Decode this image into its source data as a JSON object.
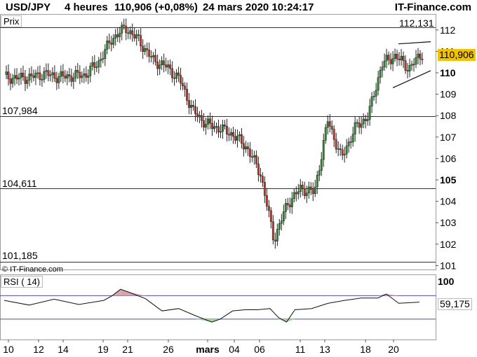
{
  "header": {
    "symbol": "USD/JPY",
    "timeframe": "4 heures",
    "price_change": "110,906 (+0,08%)",
    "datetime": "24 mars 2020 10:24:17",
    "brand": "IT-Finance.com"
  },
  "price_panel": {
    "label": "Prix",
    "watermark": "© IT-Finance.com",
    "last_price": "110,906",
    "last_price_color": "#f2c200",
    "levels": [
      {
        "label": "112,131",
        "value": 112.131
      },
      {
        "label": "107,984",
        "value": 107.984
      },
      {
        "label": "104,611",
        "value": 104.611
      },
      {
        "label": "101,185",
        "value": 101.185
      }
    ]
  },
  "rsi_panel": {
    "label": "RSI ( 14)",
    "last_value": "59,175",
    "top_tick": "100"
  },
  "colors": {
    "up": "#2e8b2e",
    "down": "#c0392b",
    "rsi_overbought_fill": "#d9a5a5",
    "rsi_oversold_fill": "#a9d9a9",
    "band_line": "#4b4bb4"
  },
  "chart_data": [
    {
      "type": "candlestick",
      "title": "USD/JPY",
      "x_tick_labels": [
        "10",
        "12",
        "14",
        "19",
        "21",
        "26",
        "mars",
        "04",
        "06",
        "11",
        "13",
        "18",
        "20"
      ],
      "y_tick_labels": [
        "101",
        "102",
        "103",
        "104",
        "105",
        "106",
        "107",
        "108",
        "109",
        "110",
        "111",
        "112"
      ],
      "y_bold_ticks": [
        "105",
        "110"
      ],
      "ylim": [
        101.0,
        112.4
      ],
      "horizontal_levels": [
        112.131,
        107.984,
        104.611,
        101.185
      ],
      "last_price": 110.906,
      "close_path": [
        {
          "date": "Feb 07",
          "close": 109.8
        },
        {
          "date": "Feb 10",
          "close": 109.75
        },
        {
          "date": "Feb 12",
          "close": 109.8
        },
        {
          "date": "Feb 13",
          "close": 109.95
        },
        {
          "date": "Feb 14",
          "close": 109.8
        },
        {
          "date": "Feb 17",
          "close": 109.85
        },
        {
          "date": "Feb 18",
          "close": 109.9
        },
        {
          "date": "Feb 19",
          "close": 110.5
        },
        {
          "date": "Feb 20",
          "close": 111.6
        },
        {
          "date": "Feb 21",
          "close": 112.1
        },
        {
          "date": "Feb 24",
          "close": 111.5
        },
        {
          "date": "Feb 25",
          "close": 110.6
        },
        {
          "date": "Feb 26",
          "close": 110.3
        },
        {
          "date": "Feb 27",
          "close": 109.7
        },
        {
          "date": "Feb 28",
          "close": 108.2
        },
        {
          "date": "Mar 02",
          "close": 107.6
        },
        {
          "date": "Mar 03",
          "close": 107.4
        },
        {
          "date": "Mar 04",
          "close": 107.1
        },
        {
          "date": "Mar 05",
          "close": 106.5
        },
        {
          "date": "Mar 06",
          "close": 105.3
        },
        {
          "date": "Mar 09",
          "close": 102.2
        },
        {
          "date": "Mar 10",
          "close": 103.9
        },
        {
          "date": "Mar 11",
          "close": 104.6
        },
        {
          "date": "Mar 12",
          "close": 104.4
        },
        {
          "date": "Mar 13",
          "close": 107.8
        },
        {
          "date": "Mar 16",
          "close": 106.0
        },
        {
          "date": "Mar 17",
          "close": 107.4
        },
        {
          "date": "Mar 18",
          "close": 108.0
        },
        {
          "date": "Mar 19",
          "close": 110.4
        },
        {
          "date": "Mar 20",
          "close": 110.8
        },
        {
          "date": "Mar 23",
          "close": 110.2
        },
        {
          "date": "Mar 24",
          "close": 110.906
        }
      ]
    },
    {
      "type": "line",
      "title": "RSI ( 14)",
      "ylim": [
        0,
        100
      ],
      "bands": [
        70,
        30
      ],
      "last_value": 59.175,
      "x": [
        0,
        0.06,
        0.12,
        0.18,
        0.24,
        0.26,
        0.28,
        0.3,
        0.34,
        0.38,
        0.42,
        0.46,
        0.5,
        0.52,
        0.55,
        0.58,
        0.61,
        0.64,
        0.66,
        0.68,
        0.7,
        0.74,
        0.78,
        0.82,
        0.86,
        0.9,
        0.92,
        0.95,
        1.0
      ],
      "y": [
        62,
        54,
        64,
        55,
        62,
        70,
        81,
        76,
        65,
        44,
        48,
        36,
        25,
        30,
        44,
        46,
        46,
        48,
        33,
        25,
        46,
        48,
        57,
        62,
        66,
        66,
        73,
        57,
        59
      ]
    }
  ]
}
